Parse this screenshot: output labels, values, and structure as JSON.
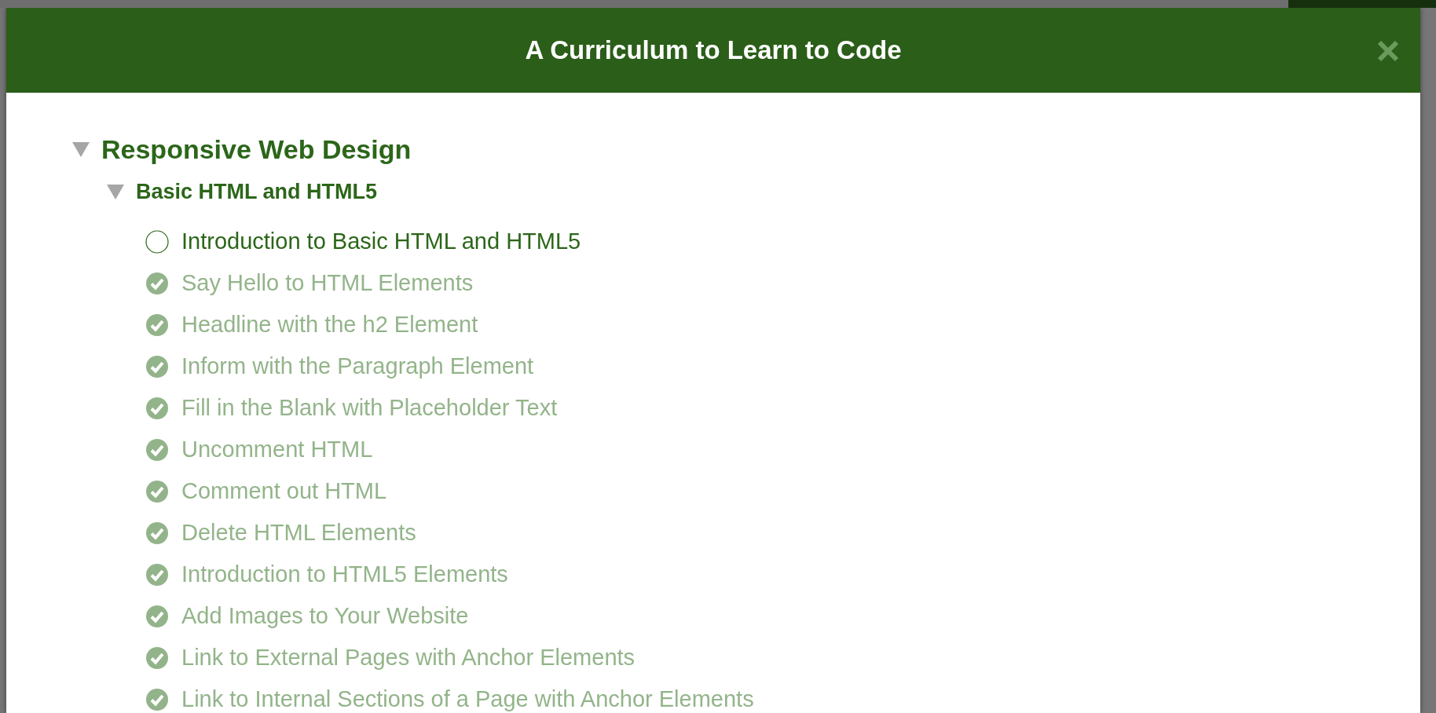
{
  "modal": {
    "title": "A Curriculum to Learn to Code"
  },
  "sections": [
    {
      "title": "Responsive Web Design",
      "expanded": true,
      "children": [
        {
          "title": "Basic HTML and HTML5",
          "expanded": true,
          "children": [
            {
              "title": "Introduction to Basic HTML and HTML5",
              "completed": false
            },
            {
              "title": "Say Hello to HTML Elements",
              "completed": true
            },
            {
              "title": "Headline with the h2 Element",
              "completed": true
            },
            {
              "title": "Inform with the Paragraph Element",
              "completed": true
            },
            {
              "title": "Fill in the Blank with Placeholder Text",
              "completed": true
            },
            {
              "title": "Uncomment HTML",
              "completed": true
            },
            {
              "title": "Comment out HTML",
              "completed": true
            },
            {
              "title": "Delete HTML Elements",
              "completed": true
            },
            {
              "title": "Introduction to HTML5 Elements",
              "completed": true
            },
            {
              "title": "Add Images to Your Website",
              "completed": true
            },
            {
              "title": "Link to External Pages with Anchor Elements",
              "completed": true
            },
            {
              "title": "Link to Internal Sections of a Page with Anchor Elements",
              "completed": true
            }
          ]
        }
      ]
    }
  ]
}
